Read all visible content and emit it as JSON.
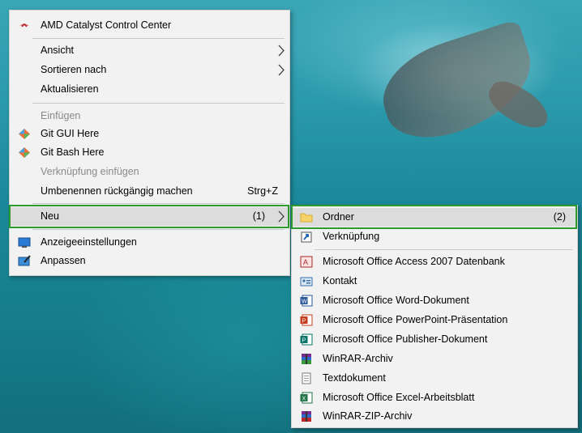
{
  "main_menu": {
    "amd_label": "AMD Catalyst Control Center",
    "ansicht_label": "Ansicht",
    "sortieren_label": "Sortieren nach",
    "aktualisieren_label": "Aktualisieren",
    "einfuegen_label": "Einfügen",
    "git_gui_label": "Git GUI Here",
    "git_bash_label": "Git Bash Here",
    "verknuepfung_einfuegen_label": "Verknüpfung einfügen",
    "umbenennen_label": "Umbenennen rückgängig machen",
    "umbenennen_shortcut": "Strg+Z",
    "neu_label": "Neu",
    "neu_marker": "(1)",
    "anzeige_label": "Anzeigeeinstellungen",
    "anpassen_label": "Anpassen"
  },
  "sub_menu": {
    "ordner_label": "Ordner",
    "ordner_marker": "(2)",
    "items": [
      "Verknüpfung",
      "Microsoft Office Access 2007 Datenbank",
      "Kontakt",
      "Microsoft Office Word-Dokument",
      "Microsoft Office PowerPoint-Präsentation",
      "Microsoft Office Publisher-Dokument",
      "WinRAR-Archiv",
      "Textdokument",
      "Microsoft Office Excel-Arbeitsblatt",
      "WinRAR-ZIP-Archiv"
    ]
  },
  "colors": {
    "highlight_border": "#2c9a2c",
    "menu_background": "#f2f2f2"
  }
}
